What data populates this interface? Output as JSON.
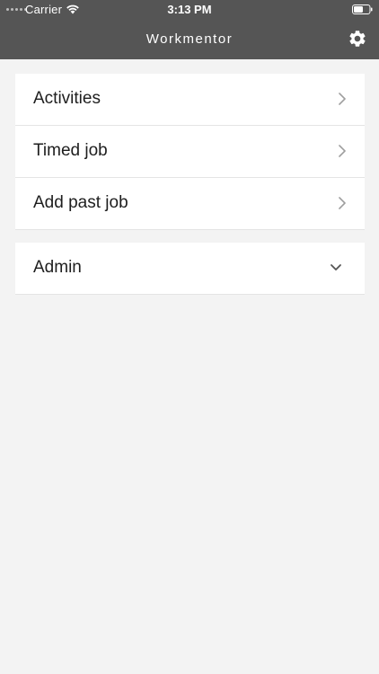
{
  "status_bar": {
    "carrier": "Carrier",
    "time": "3:13 PM",
    "icons": [
      "signal-dots-icon",
      "wifi-icon",
      "battery-icon"
    ]
  },
  "nav": {
    "title": "Workmentor",
    "settings_icon": "gear-icon"
  },
  "menu": {
    "items": [
      {
        "label": "Activities",
        "icon": "chevron-right-icon"
      },
      {
        "label": "Timed job",
        "icon": "chevron-right-icon"
      },
      {
        "label": "Add past job",
        "icon": "chevron-right-icon"
      }
    ]
  },
  "admin": {
    "label": "Admin",
    "icon": "chevron-down-icon"
  },
  "colors": {
    "header_bg": "#555555",
    "page_bg": "#f3f3f3",
    "card_bg": "#ffffff",
    "text": "#1e1e1e",
    "chevron": "#9e9e9e"
  }
}
